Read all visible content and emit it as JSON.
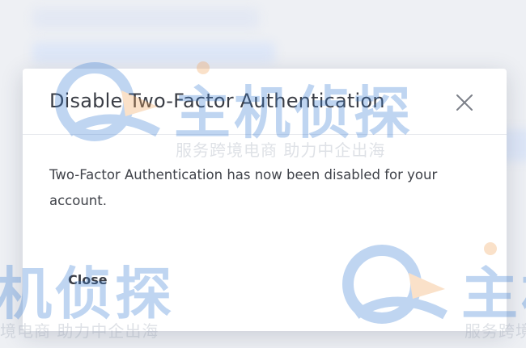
{
  "dialog": {
    "title": "Disable Two-Factor Authentication",
    "message": "Two-Factor Authentication has now been disabled for your account.",
    "close_button_label": "Close",
    "close_icon": "close-icon"
  },
  "watermark": {
    "logo_text": "主机侦探",
    "tagline": "服务跨境电商  助力中企出海",
    "tagline_partial_left": "境电商  助力中企出海",
    "tagline_partial_right": "服务跨境",
    "logo_partial_left": "机侦探",
    "logo_partial_right": "主机"
  },
  "colors": {
    "title": "#3a3d45",
    "text": "#3f4249",
    "watermark_blue": "#3b7fd4",
    "watermark_orange": "#f2a35a",
    "watermark_gray": "#9aa3b3"
  }
}
